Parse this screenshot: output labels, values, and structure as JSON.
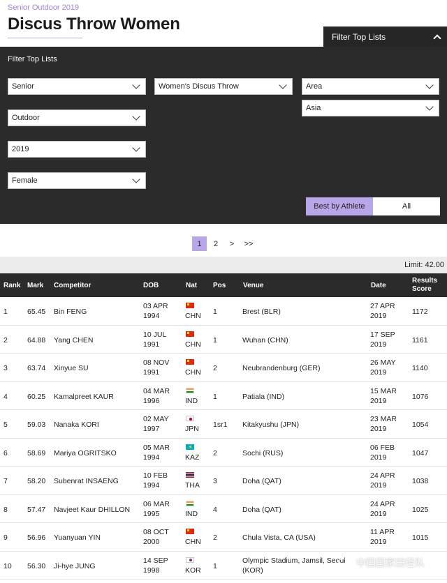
{
  "breadcrumb": "Senior Outdoor 2019",
  "page_title": "Discus Throw Women",
  "filter_toggle_label": "Filter Top Lists",
  "filter_panel": {
    "label": "Filter Top Lists",
    "age_group": "Senior",
    "environment": "Outdoor",
    "year": "2019",
    "gender": "Female",
    "discipline": "Women's Discus Throw",
    "region_type": "Area",
    "region": "Asia",
    "toggle_active": "Best by Athlete",
    "toggle_inactive": "All"
  },
  "pagination": {
    "pages": [
      "1",
      "2"
    ],
    "next": ">",
    "last": ">>",
    "current": "1"
  },
  "limit": "Limit: 42.00",
  "columns": {
    "rank": "Rank",
    "mark": "Mark",
    "competitor": "Competitor",
    "dob": "DOB",
    "nat": "Nat",
    "pos": "Pos",
    "venue": "Venue",
    "date": "Date",
    "score_line1": "Results",
    "score_line2": "Score"
  },
  "rows": [
    {
      "rank": "1",
      "mark": "65.45",
      "competitor": "Bin FENG",
      "dob1": "03 APR",
      "dob2": "1994",
      "nat": "CHN",
      "flag": "chn",
      "pos": "1",
      "venue1": "Brest (BLR)",
      "venue2": "",
      "date1": "27 APR",
      "date2": "2019",
      "score": "1172"
    },
    {
      "rank": "2",
      "mark": "64.88",
      "competitor": "Yang CHEN",
      "dob1": "10 JUL",
      "dob2": "1991",
      "nat": "CHN",
      "flag": "chn",
      "pos": "1",
      "venue1": "Wuhan (CHN)",
      "venue2": "",
      "date1": "17 SEP",
      "date2": "2019",
      "score": "1161"
    },
    {
      "rank": "3",
      "mark": "63.74",
      "competitor": "Xinyue SU",
      "dob1": "08 NOV",
      "dob2": "1991",
      "nat": "CHN",
      "flag": "chn",
      "pos": "2",
      "venue1": "Neubrandenburg (GER)",
      "venue2": "",
      "date1": "26 MAY",
      "date2": "2019",
      "score": "1140"
    },
    {
      "rank": "4",
      "mark": "60.25",
      "competitor": "Kamalpreet KAUR",
      "dob1": "04 MAR",
      "dob2": "1996",
      "nat": "IND",
      "flag": "ind",
      "pos": "1",
      "venue1": "Patiala (IND)",
      "venue2": "",
      "date1": "15 MAR",
      "date2": "2019",
      "score": "1076"
    },
    {
      "rank": "5",
      "mark": "59.03",
      "competitor": "Nanaka KORI",
      "dob1": "02 MAY",
      "dob2": "1997",
      "nat": "JPN",
      "flag": "jpn",
      "pos": "1sr1",
      "venue1": "Kitakyushu (JPN)",
      "venue2": "",
      "date1": "23 MAR",
      "date2": "2019",
      "score": "1054"
    },
    {
      "rank": "6",
      "mark": "58.69",
      "competitor": "Mariya OGRITSKO",
      "dob1": "05 MAR",
      "dob2": "1994",
      "nat": "KAZ",
      "flag": "kaz",
      "pos": "2",
      "venue1": "Sochi (RUS)",
      "venue2": "",
      "date1": "06 FEB",
      "date2": "2019",
      "score": "1047"
    },
    {
      "rank": "7",
      "mark": "58.20",
      "competitor": "Subenrat INSAENG",
      "dob1": "10 FEB",
      "dob2": "1994",
      "nat": "THA",
      "flag": "tha",
      "pos": "3",
      "venue1": "Doha (QAT)",
      "venue2": "",
      "date1": "24 APR",
      "date2": "2019",
      "score": "1038"
    },
    {
      "rank": "8",
      "mark": "57.47",
      "competitor": "Navjeet Kaur DHILLON",
      "dob1": "06 MAR",
      "dob2": "1995",
      "nat": "IND",
      "flag": "ind",
      "pos": "4",
      "venue1": "Doha (QAT)",
      "venue2": "",
      "date1": "24 APR",
      "date2": "2019",
      "score": "1025"
    },
    {
      "rank": "9",
      "mark": "56.96",
      "competitor": "Yuanyuan YIN",
      "dob1": "08 OCT",
      "dob2": "2000",
      "nat": "CHN",
      "flag": "chn",
      "pos": "2",
      "venue1": "Chula Vista, CA (USA)",
      "venue2": "",
      "date1": "11 APR",
      "date2": "2019",
      "score": "1015"
    },
    {
      "rank": "10",
      "mark": "56.30",
      "competitor": "Ji-hye JUNG",
      "dob1": "14 SEP",
      "dob2": "1998",
      "nat": "KOR",
      "flag": "kor",
      "pos": "1",
      "venue1": "Olympic Stadium, Jamsil, Seoul",
      "venue2": "(KOR)",
      "date1": "",
      "date2": "",
      "score": ""
    }
  ],
  "watermark": "中国国家田径队"
}
